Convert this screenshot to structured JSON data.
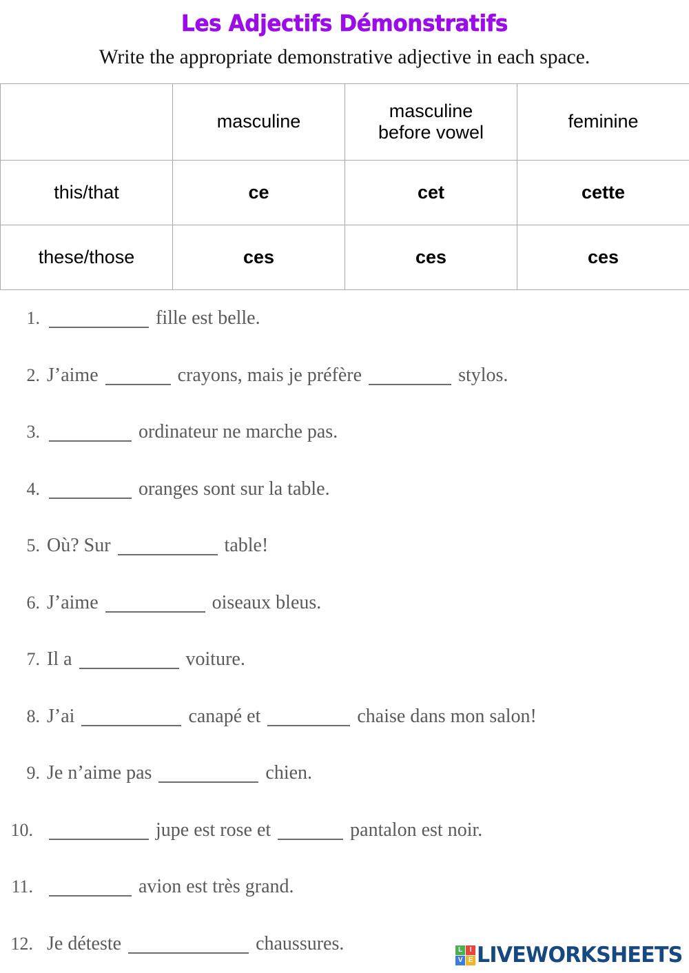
{
  "title": "Les Adjectifs Démonstratifs",
  "instruction": "Write the appropriate demonstrative adjective in each space.",
  "colors": {
    "title": "#9B0DE8",
    "ce": "#0B0BD8",
    "cet": "#F4A01E",
    "cette": "#F318CF",
    "ces": "#3C6B20",
    "logo_text": "#16497F",
    "body_text": "#5a5a5a",
    "table_border": "#a9a9a9"
  },
  "table": {
    "headers": [
      "",
      "masculine",
      "masculine before vowel",
      "feminine"
    ],
    "header_cells": {
      "corner": "",
      "masculine": "masculine",
      "masculine_before_vowel_line1": "masculine",
      "masculine_before_vowel_line2": "before vowel",
      "feminine": "feminine"
    },
    "rows": [
      {
        "label": "this/that",
        "masculine": "ce",
        "masculine_before_vowel": "cet",
        "feminine": "cette"
      },
      {
        "label": "these/those",
        "masculine": "ces",
        "masculine_before_vowel": "ces",
        "feminine": "ces"
      }
    ]
  },
  "exercises": [
    {
      "num": "1.",
      "pre": "",
      "mid": " fille est belle.",
      "post": ""
    },
    {
      "num": "2.",
      "pre": "J’aime ",
      "mid": " crayons, mais je préfère ",
      "post": " stylos."
    },
    {
      "num": "3.",
      "pre": "",
      "mid": " ordinateur ne marche pas.",
      "post": ""
    },
    {
      "num": "4.",
      "pre": "",
      "mid": " oranges sont sur la table.",
      "post": ""
    },
    {
      "num": "5.",
      "pre": "Où? Sur ",
      "mid": " table!",
      "post": ""
    },
    {
      "num": "6.",
      "pre": "J’aime ",
      "mid": " oiseaux bleus.",
      "post": ""
    },
    {
      "num": "7.",
      "pre": "Il a ",
      "mid": " voiture.",
      "post": ""
    },
    {
      "num": "8.",
      "pre": "J’ai ",
      "mid": " canapé et ",
      "post": " chaise dans mon salon!"
    },
    {
      "num": "9.",
      "pre": "Je n’aime pas ",
      "mid": " chien.",
      "post": ""
    },
    {
      "num": "10.",
      "pre": "",
      "mid": " jupe est rose et ",
      "post": " pantalon est noir."
    },
    {
      "num": "11.",
      "pre": "",
      "mid": " avion est très grand.",
      "post": ""
    },
    {
      "num": "12.",
      "pre": "Je déteste ",
      "mid": " chaussures.",
      "post": ""
    }
  ],
  "logo": {
    "squares": [
      "L",
      "I",
      "V",
      "E"
    ],
    "word": "LIVEWORKSHEETS"
  }
}
